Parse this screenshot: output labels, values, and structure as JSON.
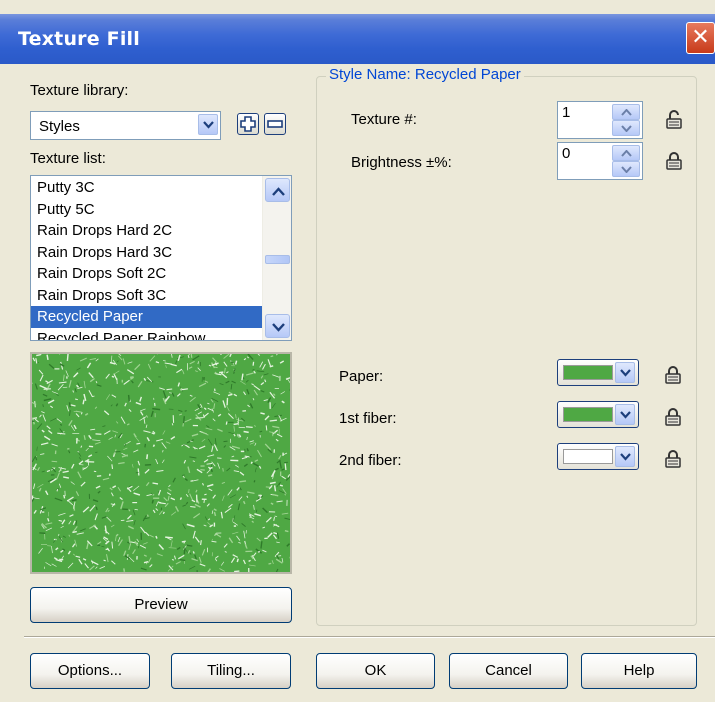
{
  "window": {
    "title": "Texture Fill",
    "close_glyph": "✕"
  },
  "library": {
    "label": "Texture library:",
    "selected": "Styles"
  },
  "list": {
    "label": "Texture list:",
    "items": [
      "Putty 3C",
      "Putty 5C",
      "Rain Drops Hard 2C",
      "Rain Drops Hard 3C",
      "Rain Drops Soft 2C",
      "Rain Drops Soft 3C",
      "Recycled Paper",
      "Recycled Paper Rainbow"
    ],
    "selected_index": 6
  },
  "preview": {
    "button_label": "Preview",
    "base_color": "#4fa844"
  },
  "style": {
    "group_title": "Style Name: Recycled Paper",
    "texture": {
      "label": "Texture #:",
      "value": "1"
    },
    "brightness": {
      "label": "Brightness ±%:",
      "value": "0"
    },
    "paper": {
      "label": "Paper:",
      "color": "#4fa844"
    },
    "fiber1": {
      "label": "1st fiber:",
      "color": "#4fa844"
    },
    "fiber2": {
      "label": "2nd fiber:",
      "color": "#ffffff"
    }
  },
  "footer": {
    "options": "Options...",
    "tiling": "Tiling...",
    "ok": "OK",
    "cancel": "Cancel",
    "help": "Help"
  },
  "icons": {
    "add": "plus-icon",
    "remove": "minus-icon",
    "lock": "lock-icon",
    "dropdown": "chevron-down-icon"
  }
}
